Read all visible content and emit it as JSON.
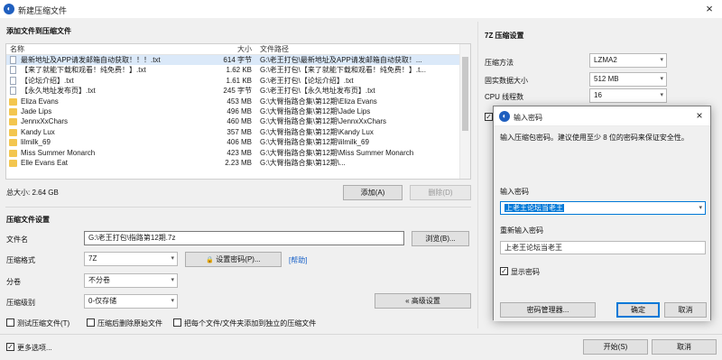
{
  "window": {
    "title": "新建压缩文件",
    "close_glyph": "×"
  },
  "files_section": {
    "title": "添加文件到压缩文件"
  },
  "file_list": {
    "columns": {
      "name": "名称",
      "size": "大小",
      "path": "文件路径"
    },
    "rows": [
      {
        "name": "最新地址及APP请发邮箱自动获取！！！.txt",
        "size": "614 字节",
        "path": "G:\\老王打包\\最新地址及APP请发邮箱自动获取！...",
        "icon": "txt"
      },
      {
        "name": "【来了就能下载和观看！纯免费！】.txt",
        "size": "1.62 KB",
        "path": "G:\\老王打包\\【来了就能下载和观看！纯免费！】.t...",
        "icon": "txt"
      },
      {
        "name": "【论坛介绍】.txt",
        "size": "1.61 KB",
        "path": "G:\\老王打包\\【论坛介绍】.txt",
        "icon": "txt"
      },
      {
        "name": "【永久地址发布页】.txt",
        "size": "245 字节",
        "path": "G:\\老王打包\\【永久地址发布页】.txt",
        "icon": "txt"
      },
      {
        "name": "Eliza Evans",
        "size": "453 MB",
        "path": "G:\\大臀指路合集\\第12期\\Eliza Evans",
        "icon": "folder"
      },
      {
        "name": "Jade Lips",
        "size": "496 MB",
        "path": "G:\\大臀指路合集\\第12期\\Jade Lips",
        "icon": "folder"
      },
      {
        "name": "JennxXxChars",
        "size": "460 MB",
        "path": "G:\\大臀指路合集\\第12期\\JennxXxChars",
        "icon": "folder"
      },
      {
        "name": "Kandy Lux",
        "size": "357 MB",
        "path": "G:\\大臀指路合集\\第12期\\Kandy Lux",
        "icon": "folder"
      },
      {
        "name": "lilmilk_69",
        "size": "406 MB",
        "path": "G:\\大臀指路合集\\第12期\\lilmilk_69",
        "icon": "folder"
      },
      {
        "name": "Miss Summer Monarch",
        "size": "423 MB",
        "path": "G:\\大臀指路合集\\第12期\\Miss Summer Monarch",
        "icon": "folder"
      },
      {
        "name": "Elle Evans Eat",
        "size": "2.23 MB",
        "path": "G:\\大臀指路合集\\第12期\\...",
        "icon": "folder"
      }
    ]
  },
  "total_size": "总大小: 2.64 GB",
  "buttons": {
    "add": "添加(A)",
    "delete": "删除(D)",
    "browse": "浏览(B)...",
    "set_password": "设置密码(P)...",
    "advanced": "« 高级设置",
    "start": "开始(S)",
    "cancel": "取消"
  },
  "help_link": "[帮助]",
  "settings_section": {
    "title": "压缩文件设置"
  },
  "settings": {
    "filename_label": "文件名",
    "filename_value": "G:\\老王打包\\指路第12期.7z",
    "format_label": "压缩格式",
    "format_value": "7Z",
    "split_label": "分卷",
    "split_value": "不分卷",
    "level_label": "压缩级别",
    "level_value": "0-仅存储"
  },
  "options": {
    "test": "测试压缩文件(T)",
    "delete_source": "压缩后删除原始文件",
    "each_separate": "把每个文件/文件夹添加到独立的压缩文件",
    "more_options": "更多选项..."
  },
  "z7_section": {
    "title": "7Z 压缩设置",
    "method_label": "压缩方法",
    "method_value": "LZMA2",
    "solid_label": "固实数据大小",
    "solid_value": "512 MB",
    "threads_label": "CPU 线程数",
    "threads_value": "16"
  },
  "password_dialog": {
    "title": "输入密码",
    "instruction": "输入压缩包密码。建议使用至少 8 位的密码来保证安全性。",
    "enter_label": "输入密码",
    "enter_value": "上老王论坛当老王",
    "reenter_label": "重新输入密码",
    "reenter_value": "上老王论坛当老王",
    "show_password": "显示密码",
    "manager": "密码管理器...",
    "ok": "确定",
    "cancel": "取消",
    "close_glyph": "×"
  },
  "colors": {
    "accent": "#0078d7",
    "app_icon": "#1f5fbf",
    "folder": "#f3c64f",
    "link": "#1a62c8"
  },
  "glyphs": {
    "check": "✓",
    "dropdown": "▾",
    "lock": "🔒",
    "app": "◐"
  }
}
